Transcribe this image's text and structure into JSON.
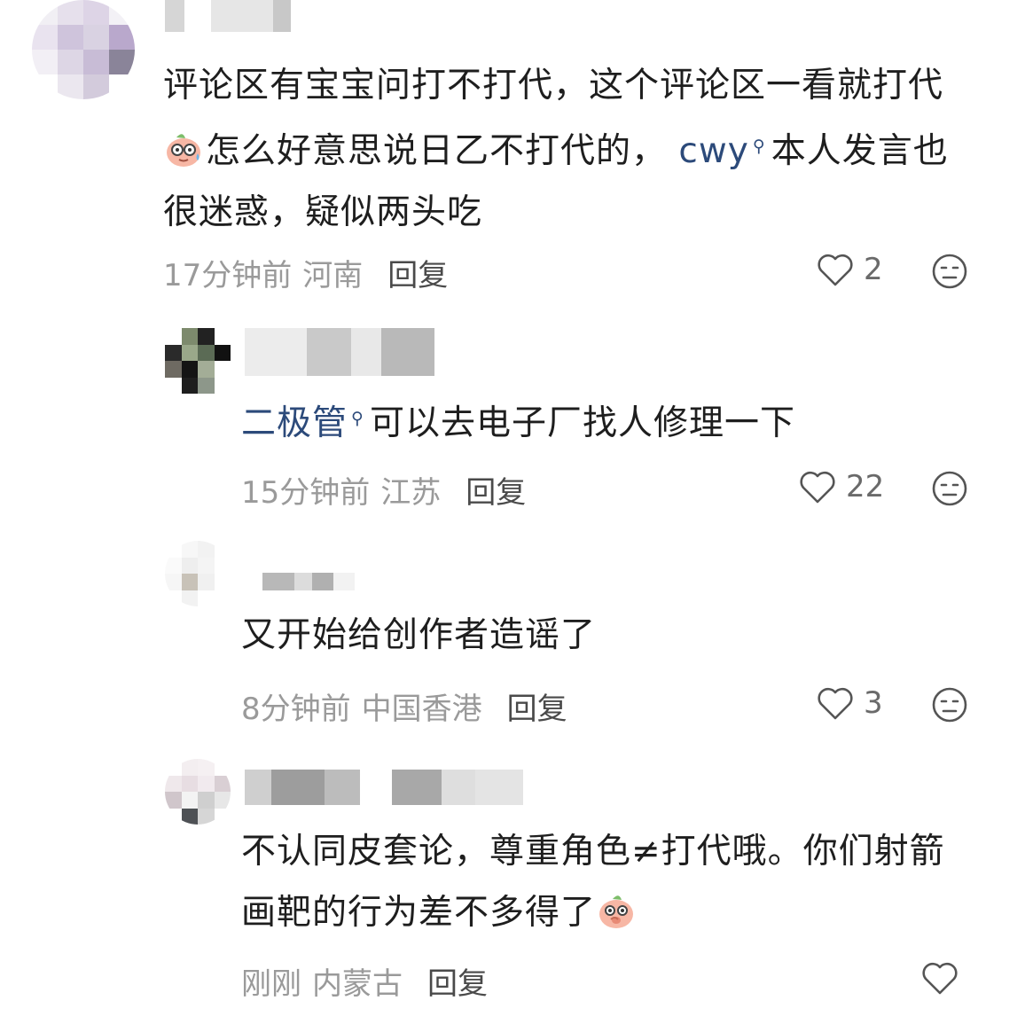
{
  "comments": [
    {
      "text_lines": [
        "评论区有宝宝问打不打代，这个评论区一看就打代",
        "怎么好意思说日乙不打代的，",
        "本人发言也",
        "很迷惑，疑似两头吃"
      ],
      "mention": "cwy",
      "time": "17分钟前",
      "region": "河南",
      "reply_label": "回复",
      "likes": "2"
    },
    {
      "mention": "二极管",
      "text": "可以去电子厂找人修理一下",
      "time": "15分钟前",
      "region": "江苏",
      "reply_label": "回复",
      "likes": "22"
    },
    {
      "text": "又开始给创作者造谣了",
      "time": "8分钟前",
      "region": "中国香港",
      "reply_label": "回复",
      "likes": "3"
    },
    {
      "text_lines": [
        "不认同皮套论，尊重角色≠打代哦。你们射箭",
        "画靶的行为差不多得了"
      ],
      "time": "刚刚",
      "region": "内蒙古",
      "reply_label": "回复",
      "likes": ""
    }
  ],
  "icons": {
    "like": "heart-outline-icon",
    "dislike": "unhappy-face-icon",
    "mention": "search-icon"
  },
  "colors": {
    "text": "#1e1e1e",
    "meta": "#9a9a9a",
    "mention": "#2c4a7a"
  }
}
